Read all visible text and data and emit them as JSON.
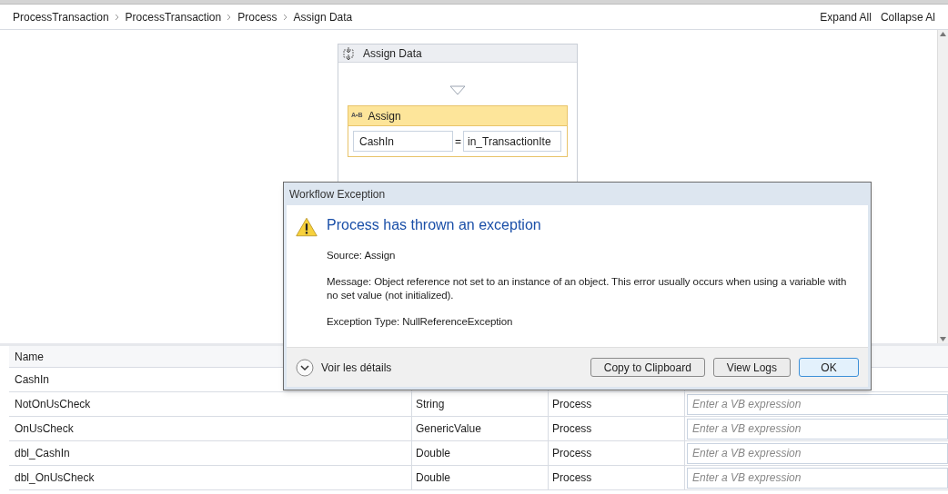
{
  "breadcrumb": [
    "ProcessTransaction",
    "ProcessTransaction",
    "Process",
    "Assign Data"
  ],
  "toolbar_links": [
    "Expand All",
    "Collapse Al"
  ],
  "sequence": {
    "title": "Assign Data",
    "assign": {
      "icon_text": "A•B",
      "title": "Assign",
      "to": "CashIn",
      "operator": "=",
      "value": "in_TransactionIte"
    }
  },
  "variables": {
    "columns": [
      "Name"
    ],
    "rows": [
      {
        "name": "CashIn"
      },
      {
        "name": "NotOnUsCheck",
        "type": "String",
        "scope": "Process",
        "default_placeholder": "Enter a VB expression"
      },
      {
        "name": "OnUsCheck",
        "type": "GenericValue",
        "scope": "Process",
        "default_placeholder": "Enter a VB expression"
      },
      {
        "name": "dbl_CashIn",
        "type": "Double",
        "scope": "Process",
        "default_placeholder": "Enter a VB expression"
      },
      {
        "name": "dbl_OnUsCheck",
        "type": "Double",
        "scope": "Process",
        "default_placeholder": "Enter a VB expression"
      }
    ]
  },
  "dialog": {
    "title": "Workflow Exception",
    "heading": "Process has thrown an exception",
    "lines": [
      "Source: Assign",
      "Message: Object reference not set to an instance of an object. This error usually occurs when using a variable with no set value (not initialized).",
      "Exception Type: NullReferenceException"
    ],
    "details_label": "Voir les détails",
    "buttons": [
      {
        "label": "Copy to Clipboard",
        "default": false
      },
      {
        "label": "View Logs",
        "default": false
      },
      {
        "label": "OK",
        "default": true
      }
    ]
  }
}
